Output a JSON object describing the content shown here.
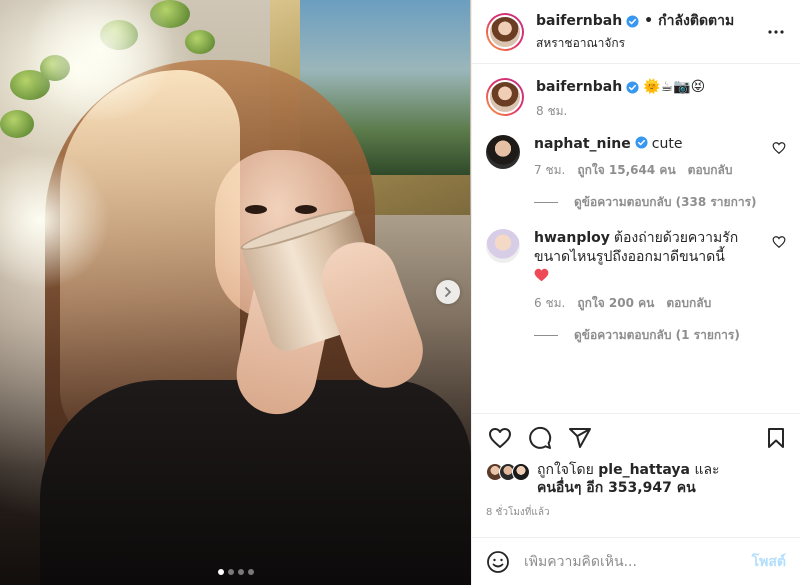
{
  "header": {
    "username": "baifernbah",
    "separator": "•",
    "follow_label": "กำลังติดตาม",
    "location": "สหราชอาณาจักร"
  },
  "caption": {
    "username": "baifernbah",
    "text": "🌞☕📷😝",
    "time": "8 ชม."
  },
  "comments": [
    {
      "username": "naphat_nine",
      "verified": true,
      "text": "cute",
      "time": "7 ชม.",
      "likes": "ถูกใจ 15,644 คน",
      "reply": "ตอบกลับ",
      "view_replies": "ดูข้อความตอบกลับ (338 รายการ)"
    },
    {
      "username": "hwanploy",
      "verified": false,
      "text": "ต้องถ่ายด้วยความรักขนาดไหนรูปถึงออกมาดีขนาดนี้",
      "emoji": "❤️",
      "time": "6 ชม.",
      "likes": "ถูกใจ 200 คน",
      "reply": "ตอบกลับ",
      "view_replies": "ดูข้อความตอบกลับ (1 รายการ)"
    }
  ],
  "likes": {
    "prefix": "ถูกใจโดย",
    "user": "ple_hattaya",
    "conj": "และ",
    "others": "คนอื่นๆ อีก 353,947 คน"
  },
  "timestamp": "8 ชั่วโมงที่แล้ว",
  "add_comment": {
    "placeholder": "เพิ่มความคิดเห็น...",
    "post_label": "โพสต์"
  },
  "carousel": {
    "count": 4,
    "active_index": 0
  },
  "colors": {
    "verified": "#3897f0",
    "heart_red": "#ed4956",
    "post_disabled": "#b2dffc",
    "meta_gray": "#8e8e8e"
  },
  "icons": [
    "chevron-right-icon",
    "more-icon",
    "verified-icon",
    "heart-icon",
    "comment-icon",
    "share-icon",
    "bookmark-icon",
    "emoji-icon"
  ]
}
